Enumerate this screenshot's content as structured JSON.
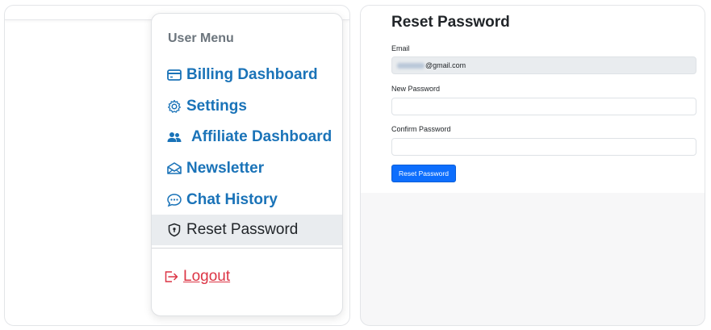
{
  "user_menu": {
    "header": "User Menu",
    "items": [
      {
        "label": "Billing Dashboard",
        "icon": "credit-card-icon",
        "active": false
      },
      {
        "label": "Settings",
        "icon": "gear-icon",
        "active": false
      },
      {
        "label": "Affiliate Dashboard",
        "icon": "people-icon",
        "active": false
      },
      {
        "label": "Newsletter",
        "icon": "envelope-icon",
        "active": false
      },
      {
        "label": "Chat History",
        "icon": "chat-dots-icon",
        "active": false
      },
      {
        "label": "Reset Password",
        "icon": "shield-lock-icon",
        "active": true
      }
    ],
    "logout_label": "Logout",
    "logout_icon": "box-arrow-right-icon"
  },
  "reset_form": {
    "title": "Reset Password",
    "email_label": "Email",
    "email_value_visible": "@gmail.com",
    "new_password_label": "New Password",
    "new_password_value": "",
    "confirm_password_label": "Confirm Password",
    "confirm_password_value": "",
    "submit_label": "Reset Password"
  },
  "colors": {
    "link_blue": "#1a73b8",
    "active_bg": "#e9ecef",
    "logout_red": "#dc3545",
    "primary_button": "#0d6efd"
  }
}
